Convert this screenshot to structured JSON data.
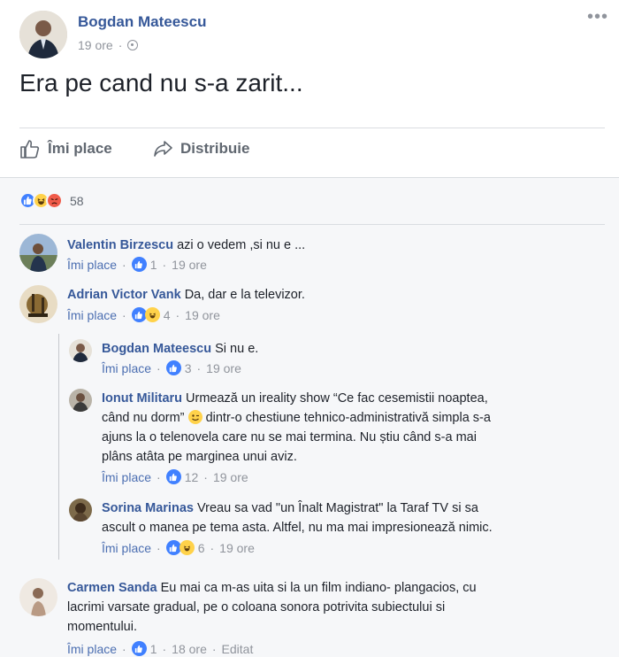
{
  "post": {
    "author": "Bogdan Mateescu",
    "time": "19 ore",
    "text": "Era pe cand nu s-a zarit...",
    "more_icon": "more-dots-icon",
    "actions": {
      "like": "Îmi place",
      "share": "Distribuie"
    },
    "reactions": {
      "count": "58",
      "types": [
        "like",
        "haha",
        "angry"
      ]
    }
  },
  "comments": [
    {
      "author": "Valentin Birzescu",
      "text": "azi o vedem ,si nu e ...",
      "like": "Îmi place",
      "likes": "1",
      "time": "19 ore"
    },
    {
      "author": "Adrian Victor Vank",
      "text": "Da, dar e la televizor.",
      "like": "Îmi place",
      "likes": "4",
      "time": "19 ore"
    },
    {
      "author": "Bogdan Mateescu",
      "text": "Si nu e.",
      "like": "Îmi place",
      "likes": "3",
      "time": "19 ore"
    },
    {
      "author": "Ionut Militaru",
      "text_a": "Urmează un ireality show “Ce fac cesemistii noaptea,",
      "text_b": "când nu dorm”",
      "text_c": "dintr-o chestiune tehnico-administrativă simpla s-a",
      "text_d": "ajuns la o telenovela care nu se mai termina. Nu știu când s-a mai",
      "text_e": "plâns atâta pe marginea unui aviz.",
      "like": "Îmi place",
      "likes": "12",
      "time": "19 ore"
    },
    {
      "author": "Sorina Marinas",
      "text_a": "Vreau sa vad \"un Înalt Magistrat\" la Taraf TV si sa",
      "text_b": "ascult o manea pe tema asta. Altfel, nu ma mai impresionează nimic.",
      "like": "Îmi place",
      "likes": "6",
      "time": "19 ore"
    },
    {
      "author": "Carmen Sanda",
      "text_a": "Eu mai ca m-as uita si la un film indiano- plangacios, cu",
      "text_b": "lacrimi varsate gradual, pe o coloana sonora potrivita subiectului si",
      "text_c": "momentului.",
      "like": "Îmi place",
      "likes": "1",
      "time": "18 ore",
      "edited": "Editat"
    }
  ],
  "colors": {
    "link": "#365899",
    "meta": "#90949c",
    "like_blue": "#4080ff",
    "haha_yellow": "#ffd24a",
    "angry_red": "#f05b4a"
  }
}
